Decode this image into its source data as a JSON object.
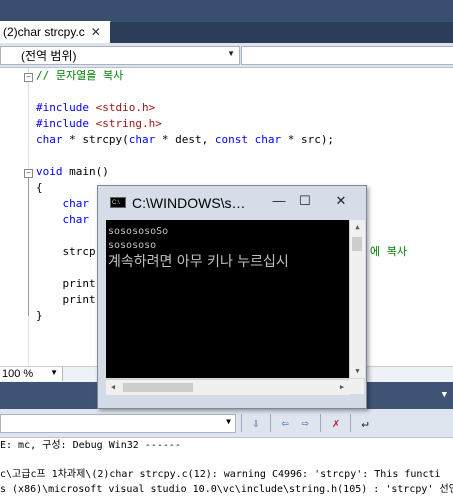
{
  "editor_tab": {
    "label": "(2)char strcpy.c",
    "close_icon": "close-icon"
  },
  "navbar": {
    "scope": "(전역 범위)"
  },
  "code": {
    "lines": [
      "// 문자열을 복사",
      "",
      "#include <stdio.h>",
      "#include <string.h>",
      "char * strcpy(char * dest, const char * src);",
      "",
      "void main()",
      "{",
      "    char",
      "    char",
      "",
      "    strcp",
      "",
      "    print",
      "    print",
      "}"
    ],
    "hidden_right_fragment": "에 복사"
  },
  "zoom": {
    "value": "100 %"
  },
  "console": {
    "title": "C:\\WINDOWS\\s…",
    "output": [
      "sosososoSo",
      "sosososo",
      "계속하려면 아무 키나 누르십시"
    ],
    "buttons": {
      "minimize": "—",
      "maximize": "☐",
      "close": "✕"
    }
  },
  "output_panel": {
    "lines": [
      "E: mc, 구성: Debug Win32 ------",
      "",
      "c\\고급c프 1차과제\\(2)char strcpy.c(12): warning C4996: 'strcpy': This functi",
      "s (x86)\\microsoft visual studio 10.0\\vc\\include\\string.h(105) : 'strcpy' 선언"
    ]
  }
}
